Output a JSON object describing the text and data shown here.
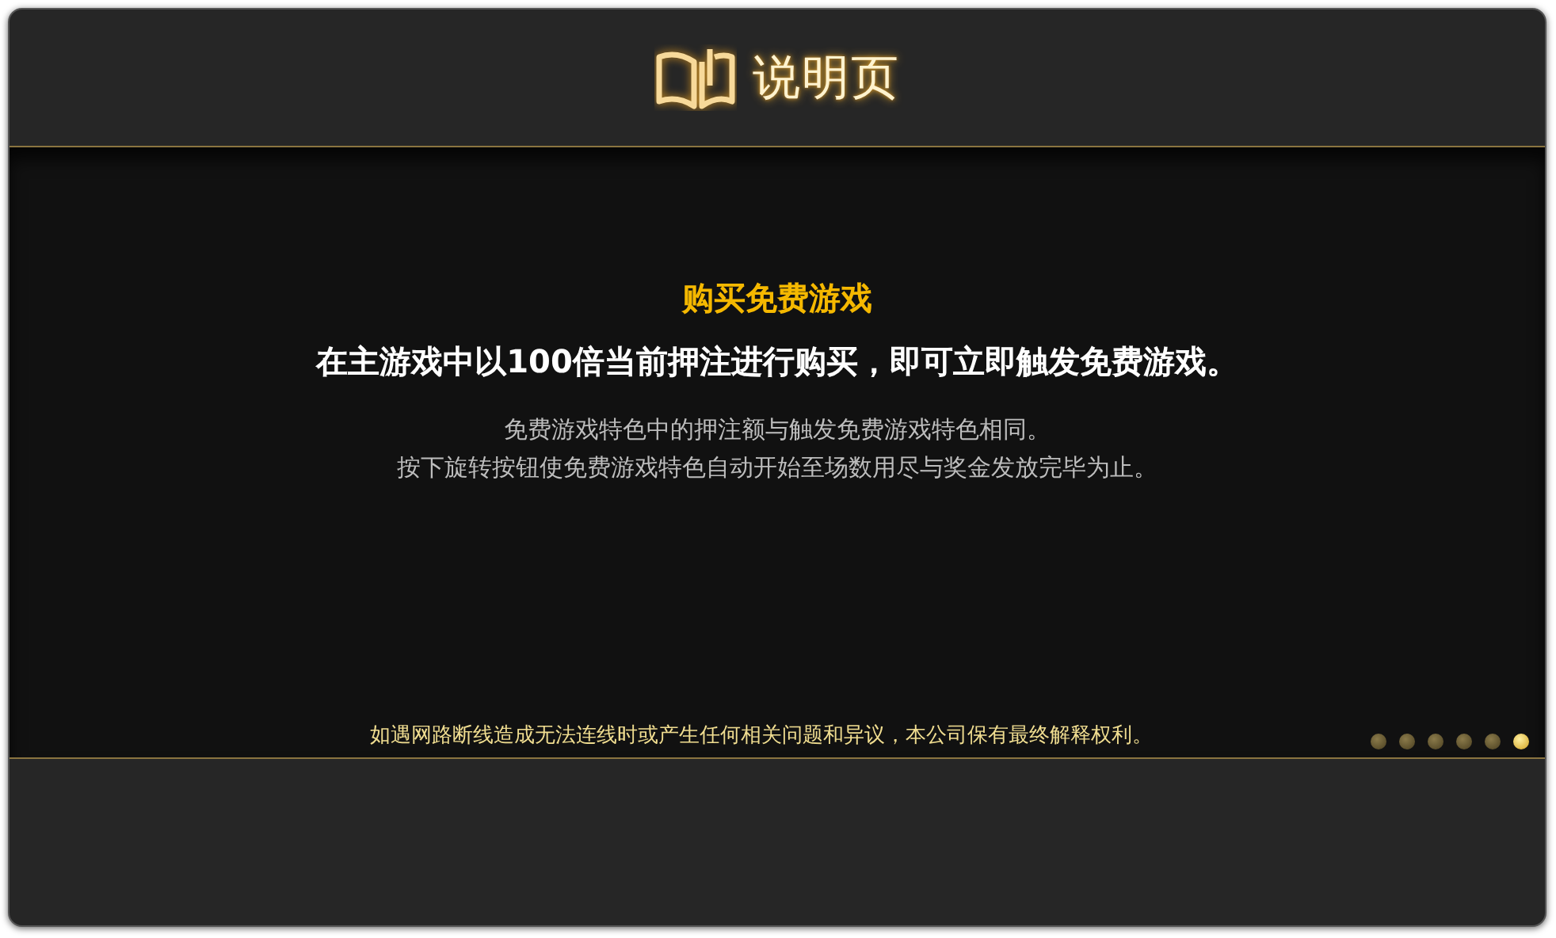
{
  "header": {
    "title": "说明页"
  },
  "content": {
    "heading": "购买免费游戏",
    "lead": "在主游戏中以100倍当前押注进行购买，即可立即触发免费游戏。",
    "lines": [
      "免费游戏特色中的押注额与触发免费游戏特色相同。",
      "按下旋转按钮使免费游戏特色自动开始至场数用尽与奖金发放完毕为止。"
    ]
  },
  "disclaimer": "如遇网路断线造成无法连线时或产生任何相关问题和异议，本公司保有最终解释权利。",
  "pages": [
    {
      "selected": false
    },
    {
      "selected": false
    },
    {
      "selected": false
    },
    {
      "selected": false
    },
    {
      "selected": false
    },
    {
      "selected": true
    }
  ]
}
